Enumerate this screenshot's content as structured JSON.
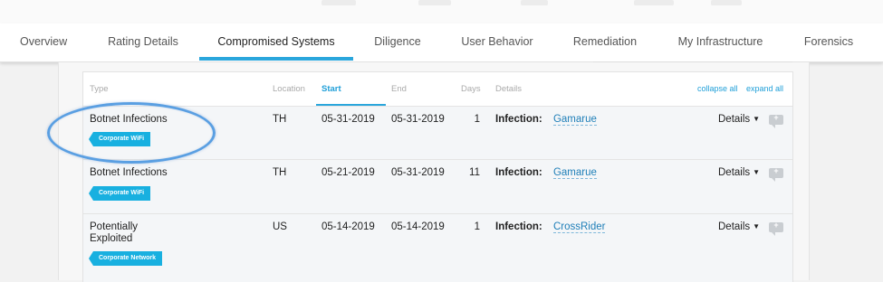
{
  "tabs": [
    {
      "label": "Overview"
    },
    {
      "label": "Rating Details"
    },
    {
      "label": "Compromised Systems"
    },
    {
      "label": "Diligence"
    },
    {
      "label": "User Behavior"
    },
    {
      "label": "Remediation"
    },
    {
      "label": "My Infrastructure"
    },
    {
      "label": "Forensics"
    }
  ],
  "active_tab": "Compromised Systems",
  "table": {
    "columns": {
      "type": "Type",
      "location": "Location",
      "start": "Start",
      "end": "End",
      "days": "Days",
      "details": "Details"
    },
    "sorted_by": "Start",
    "collapse_all": "collapse all",
    "expand_all": "expand all",
    "rows": [
      {
        "type": "Botnet Infections",
        "badge": "Corporate WiFi",
        "location": "TH",
        "start": "05-31-2019",
        "end": "05-31-2019",
        "days": "1",
        "infection_label": "Infection:",
        "infection": "Gamarue",
        "details_label": "Details"
      },
      {
        "type": "Botnet Infections",
        "badge": "Corporate WiFi",
        "location": "TH",
        "start": "05-21-2019",
        "end": "05-31-2019",
        "days": "11",
        "infection_label": "Infection:",
        "infection": "Gamarue",
        "details_label": "Details"
      },
      {
        "type": "Potentially Exploited",
        "badge": "Corporate Network",
        "location": "US",
        "start": "05-14-2019",
        "end": "05-14-2019",
        "days": "1",
        "infection_label": "Infection:",
        "infection": "CrossRider",
        "details_label": "Details"
      }
    ]
  },
  "colors": {
    "accent": "#2aa6dc",
    "badge": "#18b0e0",
    "annotation": "#5a9fe2"
  },
  "icons": {
    "details_toggle": "chevron-down-icon",
    "comment": "add-comment-icon"
  }
}
